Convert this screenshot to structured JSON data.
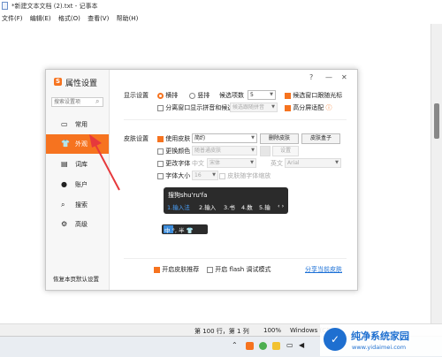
{
  "notepad": {
    "title": "*新建文本文档 (2).txt - 记事本",
    "menu": [
      "文件(F)",
      "编辑(E)",
      "格式(O)",
      "查看(V)",
      "帮助(H)"
    ],
    "status": {
      "position": "第 100 行，第 1 列",
      "zoom": "100%",
      "eol": "Windows (CRLF)"
    }
  },
  "dialog": {
    "title": "属性设置",
    "help": "?",
    "minimize": "—",
    "close": "✕",
    "search_placeholder": "搜索设置项",
    "nav": [
      {
        "icon": "monitor-icon",
        "glyph": "▭",
        "label": "常用"
      },
      {
        "icon": "shirt-icon",
        "glyph": "👕",
        "label": "外观"
      },
      {
        "icon": "book-icon",
        "glyph": "▤",
        "label": "词库"
      },
      {
        "icon": "person-icon",
        "glyph": "●",
        "label": "账户"
      },
      {
        "icon": "search-icon",
        "glyph": "⌕",
        "label": "搜索"
      },
      {
        "icon": "gear-icon",
        "glyph": "⚙",
        "label": "高级"
      }
    ],
    "reset": "恢复本页默认设置",
    "display": {
      "section": "显示设置",
      "horizontal": "横排",
      "vertical": "竖排",
      "candidate_count_label": "候选项数",
      "candidate_count": "5",
      "follow_cursor": "候选窗口跟随光标",
      "separate_pinyin": "分离窗口显示拼音和候选",
      "separate_mode": "候选跟随拼音",
      "hidpi": "高分屏适配"
    },
    "skin": {
      "section": "皮肤设置",
      "use_skin": "使用皮肤",
      "skin_name": "简约",
      "delete_skin": "删除皮肤",
      "skin_box": "皮肤盒子",
      "change_color": "更换颜色",
      "color_value": "随普通皮肤",
      "color_settings": "设置",
      "change_font": "更改字体",
      "chinese_label": "中文",
      "chinese_font": "宋体",
      "english_label": "英文",
      "english_font": "Arial",
      "font_size_label": "字体大小",
      "font_size": "16",
      "scale_with_skin": "皮肤随字体缩放"
    },
    "preview": {
      "composition": "搜狗shu'ru'fa",
      "candidates": [
        "1.输入法",
        "2.输入",
        "3.书",
        "4.数",
        "5.输"
      ],
      "more": "‹ ›",
      "status_bar": "中 °, 半 👕"
    },
    "footer": {
      "skin_recommend": "开启皮肤推荐",
      "flash_debug": "开启 flash 调试模式",
      "share": "分享当前皮肤"
    }
  },
  "watermark": {
    "brand": "纯净系统家园",
    "url": "www.yidaimei.com"
  },
  "colors": {
    "accent": "#f6731f",
    "arrow": "#e6393c"
  }
}
